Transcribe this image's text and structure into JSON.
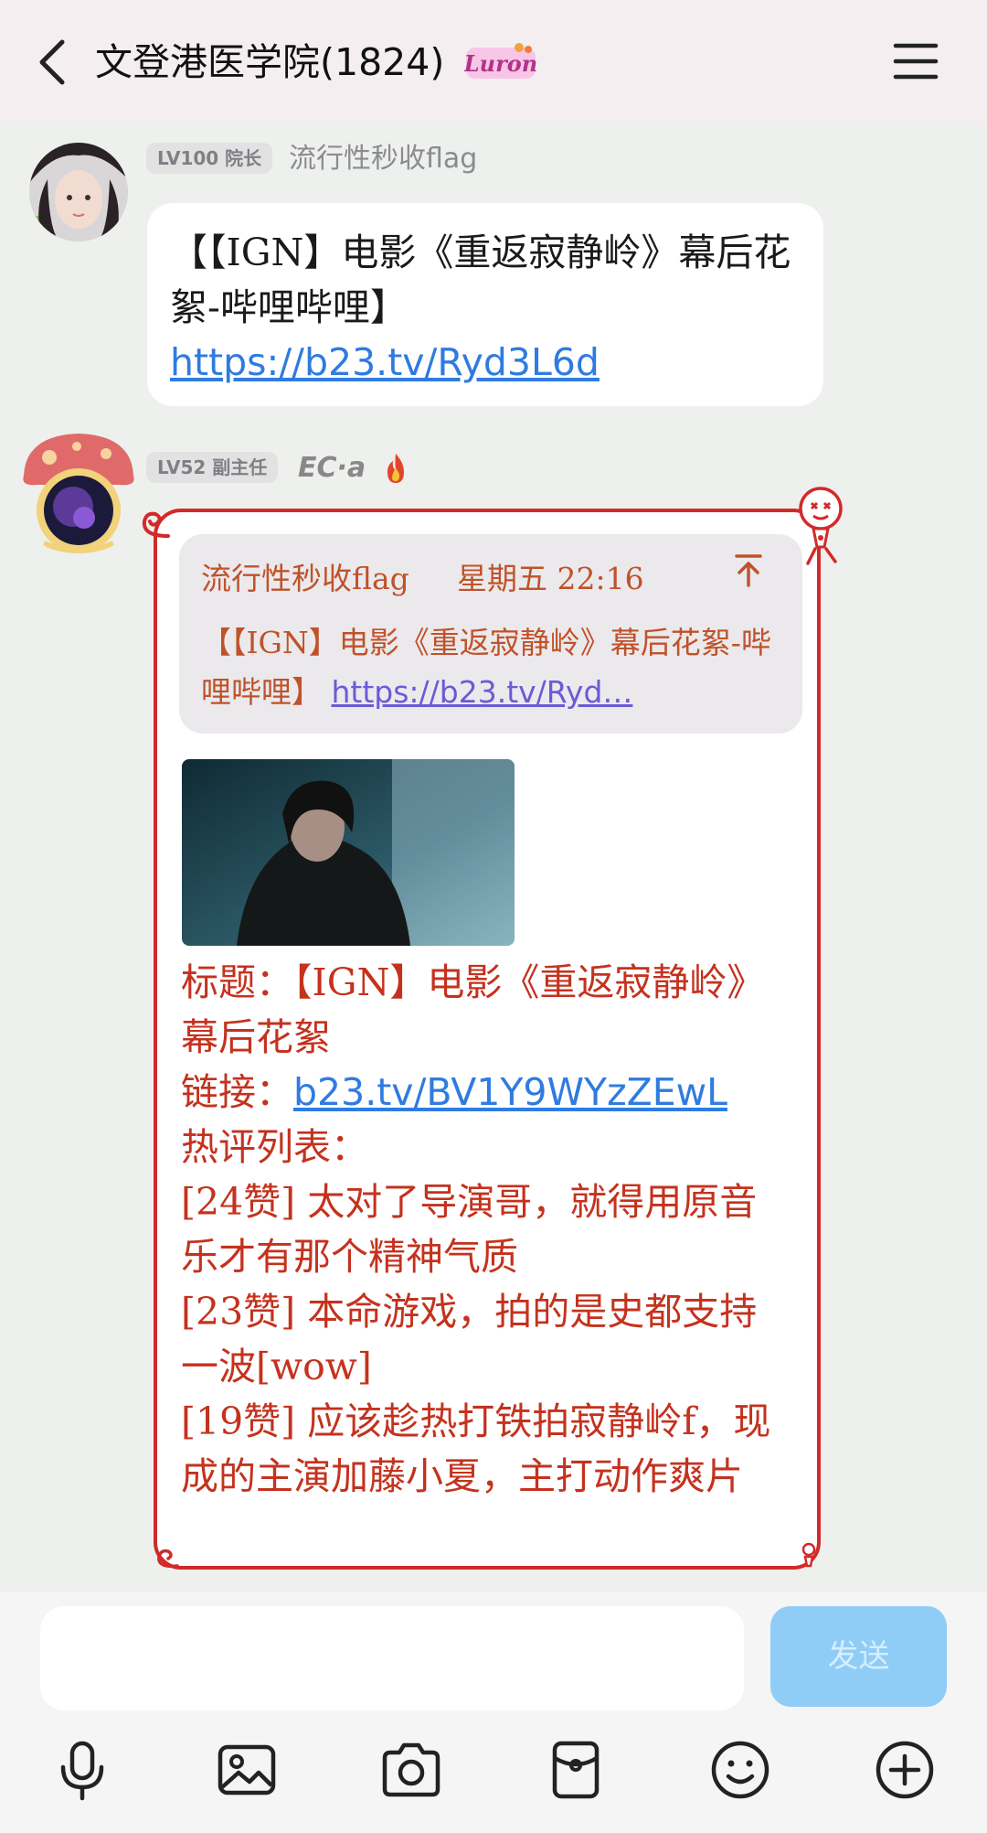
{
  "header": {
    "title": "文登港医学院(1824)",
    "brand_badge": "Luron",
    "back_icon": "chevron-left-icon",
    "menu_icon": "hamburger-menu-icon"
  },
  "messages": [
    {
      "level": "LV100 院长",
      "nickname": "流行性秒收flag",
      "text": "【【IGN】电影《重返寂静岭》幕后花絮-哔哩哔哩】",
      "link": "https://b23.tv/Ryd3L6d"
    },
    {
      "level": "LV52 副主任",
      "nickname": "EC·a",
      "nickname_icon": "flame-icon",
      "quote": {
        "author": "流行性秒收flag",
        "time": "星期五 22:16",
        "text": "【【IGN】电影《重返寂静岭》幕后花絮-哔哩哔哩】",
        "link": "https://b23.tv/Ryd…",
        "jump_icon": "arrow-up-to-top-icon"
      },
      "card": {
        "title_line": "标题：【IGN】电影《重返寂静岭》幕后花絮",
        "link_label": "链接：",
        "link": "b23.tv/BV1Y9WYzZEwL",
        "hot_label": "热评列表：",
        "comments": [
          "[24赞] 太对了导演哥，就得用原音乐才有那个精神气质",
          "[23赞] 本命游戏，拍的是史都支持一波[wow]",
          "[19赞] 应该趁热打铁拍寂静岭f，现成的主演加藤小夏，主打动作爽片"
        ]
      }
    }
  ],
  "input": {
    "value": "",
    "send_label": "发送"
  },
  "toolbar": [
    "microphone-icon",
    "image-icon",
    "camera-icon",
    "red-packet-icon",
    "emoji-icon",
    "plus-icon"
  ],
  "colors": {
    "header_bg": "#f4eef1",
    "chat_bg": "#eef0ed",
    "bubble_border": "#d22a2a",
    "card_text": "#c4321e",
    "link": "#2f7be0",
    "send_button": "#8fcdf7"
  }
}
